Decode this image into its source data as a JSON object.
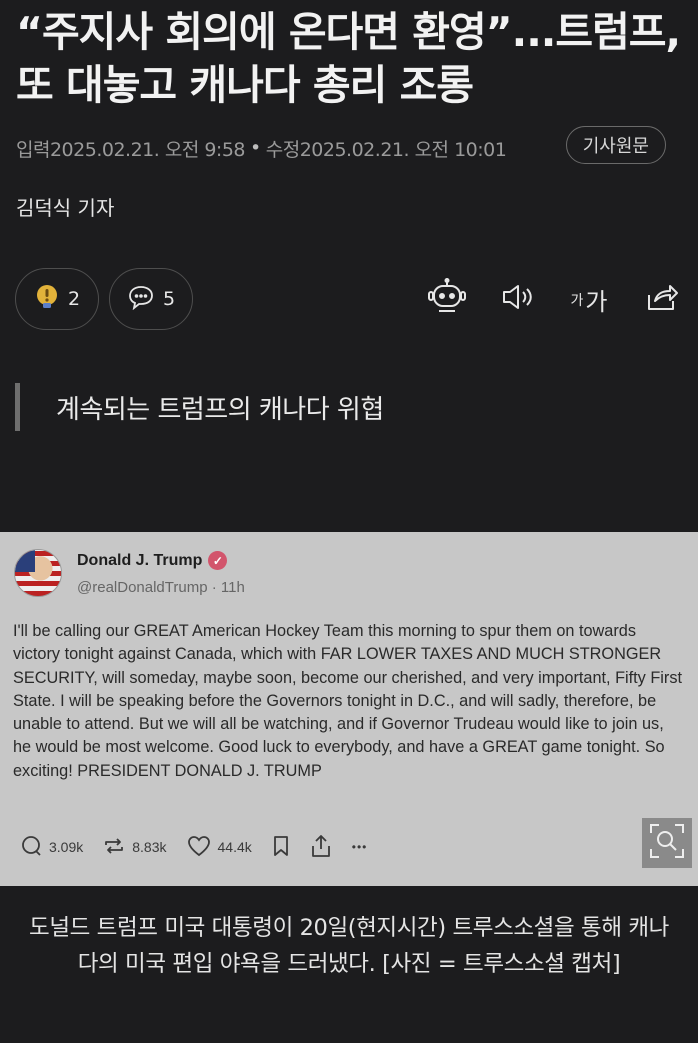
{
  "article": {
    "headline": "“주지사 회의에 온다면 환영”...트럼프, 또 대놓고 캐나다 총리 조롱",
    "input_label": "입력",
    "input_time": "2025.02.21. 오전 9:58",
    "separator": "•",
    "modified_label": "수정",
    "modified_time": "2025.02.21. 오전 10:01",
    "original_button": "기사원문",
    "reporter": "김덕식 기자",
    "reaction_count": "2",
    "comment_count": "5",
    "font_size_label_small": "가",
    "font_size_label_large": "가",
    "subheading": "계속되는 트럼프의 캐나다 위협"
  },
  "embedded_post": {
    "author": "Donald J. Trump",
    "handle": "@realDonaldTrump · 11h",
    "text": "I'll be calling our GREAT American Hockey Team this morning to spur them on towards victory tonight against Canada, which with FAR LOWER TAXES AND MUCH STRONGER SECURITY, will someday, maybe soon, become our cherished, and very important, Fifty First State. I will be speaking before the Governors tonight in D.C., and will sadly, therefore, be unable to attend. But we will all be watching, and if Governor Trudeau would like to join us, he would be most welcome. Good luck to everybody, and have a GREAT game tonight. So exciting! PRESIDENT DONALD J. TRUMP",
    "replies": "3.09k",
    "retruths": "8.83k",
    "likes": "44.4k",
    "more": "•••"
  },
  "caption": "도널드 트럼프 미국 대통령이 20일(현지시간) 트루스소셜을 통해 캐나다의 미국 편입 야욕을 드러냈다. [사진 = 트루스소셜 캡처]",
  "colors": {
    "background": "#1c1c1e",
    "post_background": "#c7c7c7",
    "verified_badge": "#d2556c"
  }
}
